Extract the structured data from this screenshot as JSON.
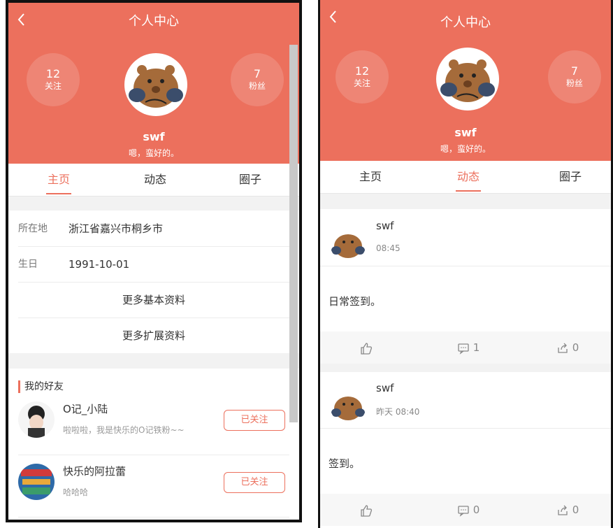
{
  "left": {
    "header": {
      "title": "个人中心"
    },
    "stats": {
      "following": {
        "count": "12",
        "label": "关注"
      },
      "fans": {
        "count": "7",
        "label": "粉丝"
      }
    },
    "profile": {
      "username": "swf",
      "signature": "嗯，蛮好的。"
    },
    "tabs": [
      "主页",
      "动态",
      "圈子"
    ],
    "active_tab": "主页",
    "info": [
      {
        "key": "所在地",
        "value": "浙江省嘉兴市桐乡市"
      },
      {
        "key": "生日",
        "value": "1991-10-01"
      }
    ],
    "links": [
      "更多基本资料",
      "更多扩展资料"
    ],
    "friends_title": "我的好友",
    "friends": [
      {
        "name": "O记_小陆",
        "desc": "啦啦啦，我是快乐的O记铁粉~~",
        "button": "已关注"
      },
      {
        "name": "快乐的阿拉蕾",
        "desc": "哈哈哈",
        "button": "已关注"
      }
    ]
  },
  "right": {
    "header": {
      "title": "个人中心"
    },
    "stats": {
      "following": {
        "count": "12",
        "label": "关注"
      },
      "fans": {
        "count": "7",
        "label": "粉丝"
      }
    },
    "profile": {
      "username": "swf",
      "signature": "嗯，蛮好的。"
    },
    "tabs": [
      "主页",
      "动态",
      "圈子"
    ],
    "active_tab": "动态",
    "posts": [
      {
        "author": "swf",
        "time": "08:45",
        "content": "日常签到。",
        "likes": "",
        "comments": "1",
        "shares": "0"
      },
      {
        "author": "swf",
        "time": "昨天 08:40",
        "content": "签到。",
        "likes": "",
        "comments": "0",
        "shares": "0"
      }
    ]
  },
  "colors": {
    "accent": "#ec705d",
    "gap": "#f2f2f2"
  }
}
